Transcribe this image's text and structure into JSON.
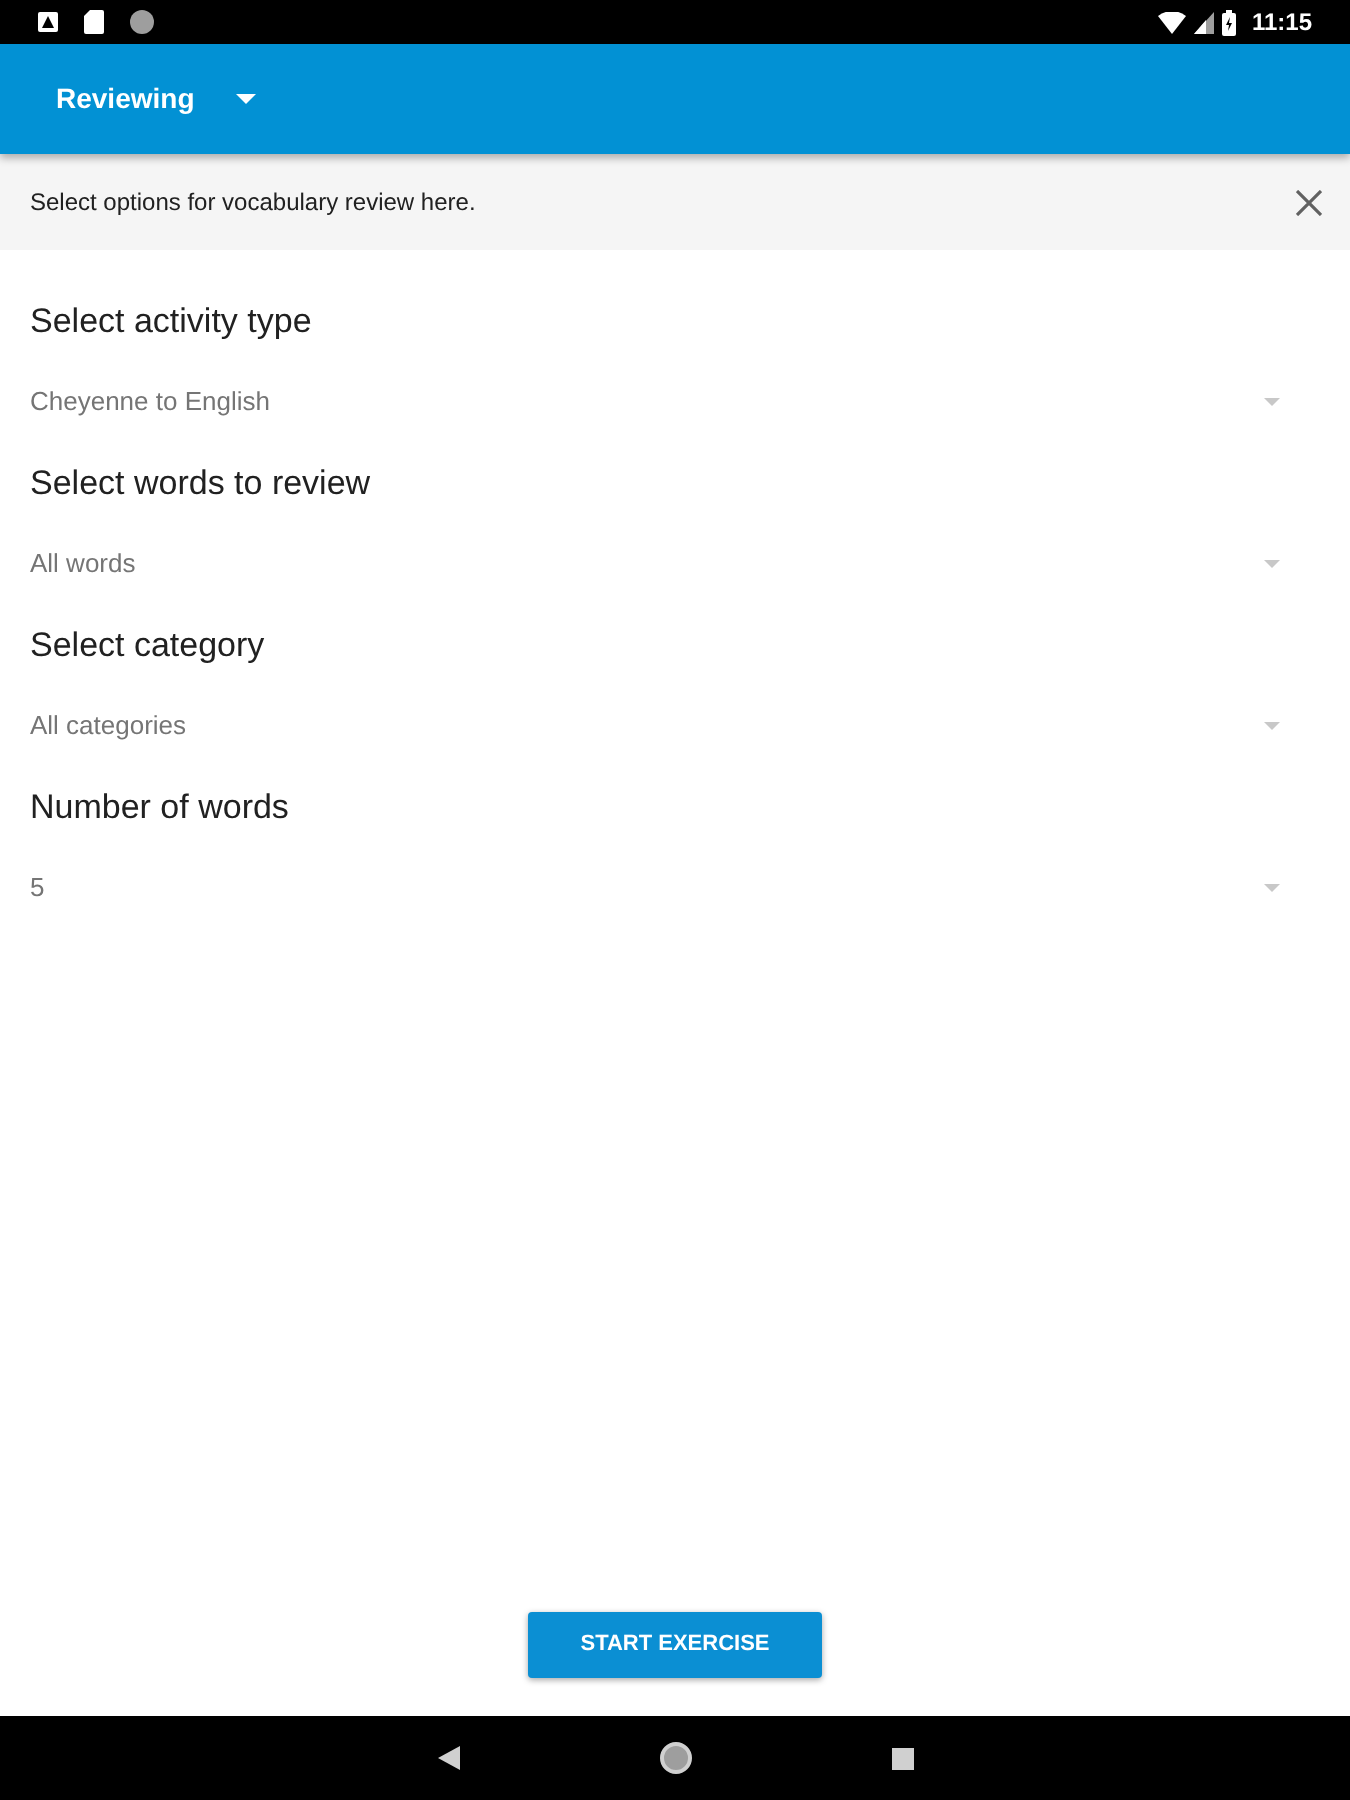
{
  "status_bar": {
    "time": "11:15"
  },
  "app_bar": {
    "title": "Reviewing"
  },
  "banner": {
    "text": "Select options for vocabulary review here."
  },
  "fields": [
    {
      "label": "Select activity type",
      "value": "Cheyenne to English"
    },
    {
      "label": "Select words to review",
      "value": "All words"
    },
    {
      "label": "Select category",
      "value": "All categories"
    },
    {
      "label": "Number of words",
      "value": "5"
    }
  ],
  "button": {
    "label": "START EXERCISE"
  }
}
